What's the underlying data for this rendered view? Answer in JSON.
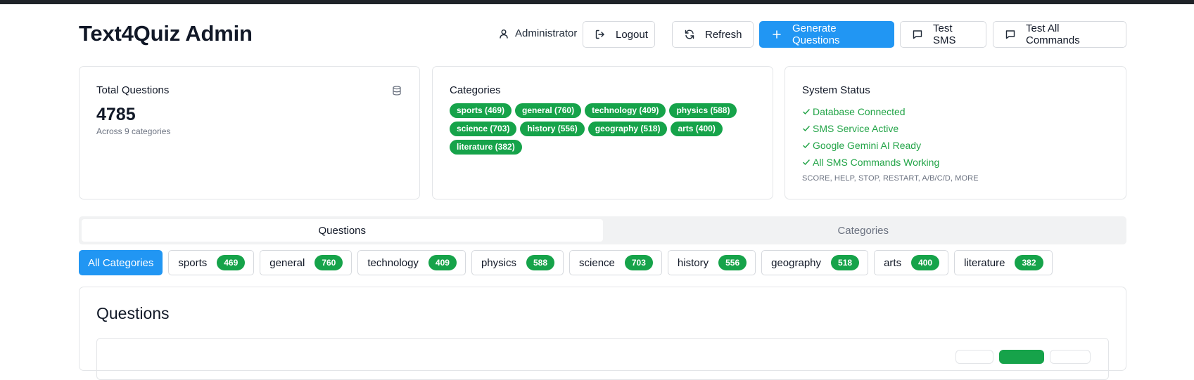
{
  "header": {
    "title": "Text4Quiz Admin",
    "user": "Administrator",
    "buttons": {
      "logout": "Logout",
      "refresh": "Refresh",
      "generate": "Generate Questions",
      "test_sms": "Test SMS",
      "test_all": "Test All Commands"
    }
  },
  "stats": {
    "total": {
      "title": "Total Questions",
      "value": "4785",
      "subtitle": "Across 9 categories"
    },
    "categories": {
      "title": "Categories",
      "items": [
        "sports (469)",
        "general (760)",
        "technology (409)",
        "physics (588)",
        "science (703)",
        "history (556)",
        "geography (518)",
        "arts (400)",
        "literature (382)"
      ]
    },
    "status": {
      "title": "System Status",
      "items": [
        "Database Connected",
        "SMS Service Active",
        "Google Gemini AI Ready",
        "All SMS Commands Working"
      ],
      "note": "SCORE, HELP, STOP, RESTART, A/B/C/D, MORE"
    }
  },
  "tabs": [
    "Questions",
    "Categories"
  ],
  "filters": {
    "all_label": "All Categories",
    "items": [
      {
        "name": "sports",
        "count": "469"
      },
      {
        "name": "general",
        "count": "760"
      },
      {
        "name": "technology",
        "count": "409"
      },
      {
        "name": "physics",
        "count": "588"
      },
      {
        "name": "science",
        "count": "703"
      },
      {
        "name": "history",
        "count": "556"
      },
      {
        "name": "geography",
        "count": "518"
      },
      {
        "name": "arts",
        "count": "400"
      },
      {
        "name": "literature",
        "count": "382"
      }
    ]
  },
  "questions": {
    "title": "Questions"
  },
  "colors": {
    "primary": "#2196f3",
    "success": "#16a34a",
    "status_text": "#22a447",
    "topbar": "#1f2328"
  }
}
